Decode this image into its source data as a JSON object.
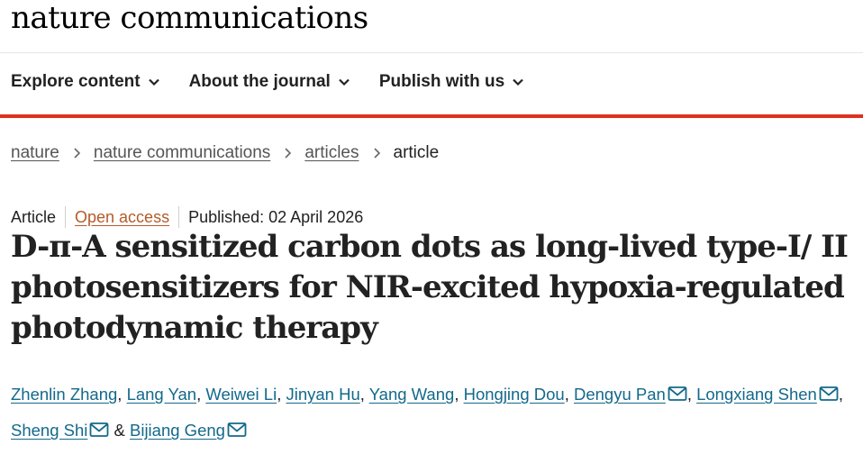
{
  "header": {
    "brand": "nature communications"
  },
  "nav": {
    "items": [
      {
        "label": "Explore content"
      },
      {
        "label": "About the journal"
      },
      {
        "label": "Publish with us"
      }
    ]
  },
  "breadcrumb": {
    "items": [
      {
        "label": "nature"
      },
      {
        "label": "nature communications"
      },
      {
        "label": "articles"
      },
      {
        "label": "article"
      }
    ]
  },
  "article": {
    "type": "Article",
    "access": "Open access",
    "published": "Published: 02 April 2026",
    "title": "D-π-A sensitized carbon dots as long-lived type-I/ II photosensitizers for NIR-excited hypoxia-regulated photodynamic therapy",
    "authors": [
      {
        "name": "Zhenlin Zhang",
        "email": false
      },
      {
        "name": "Lang Yan",
        "email": false
      },
      {
        "name": "Weiwei Li",
        "email": false
      },
      {
        "name": "Jinyan Hu",
        "email": false
      },
      {
        "name": "Yang Wang",
        "email": false
      },
      {
        "name": "Hongjing Dou",
        "email": false
      },
      {
        "name": "Dengyu Pan",
        "email": true
      },
      {
        "name": "Longxiang Shen",
        "email": true
      },
      {
        "name": "Sheng Shi",
        "email": true
      },
      {
        "name": "Bijiang Geng",
        "email": true
      }
    ],
    "author_separator": ", ",
    "last_separator": " & "
  },
  "colors": {
    "accent_red": "#e0301e",
    "link_blue": "#13698b",
    "open_access_orange": "#b35b29"
  },
  "icons": {
    "nav_dropdown": "chevron-down-icon",
    "breadcrumb_separator": "chevron-right-icon",
    "author_contact": "mail-icon"
  }
}
